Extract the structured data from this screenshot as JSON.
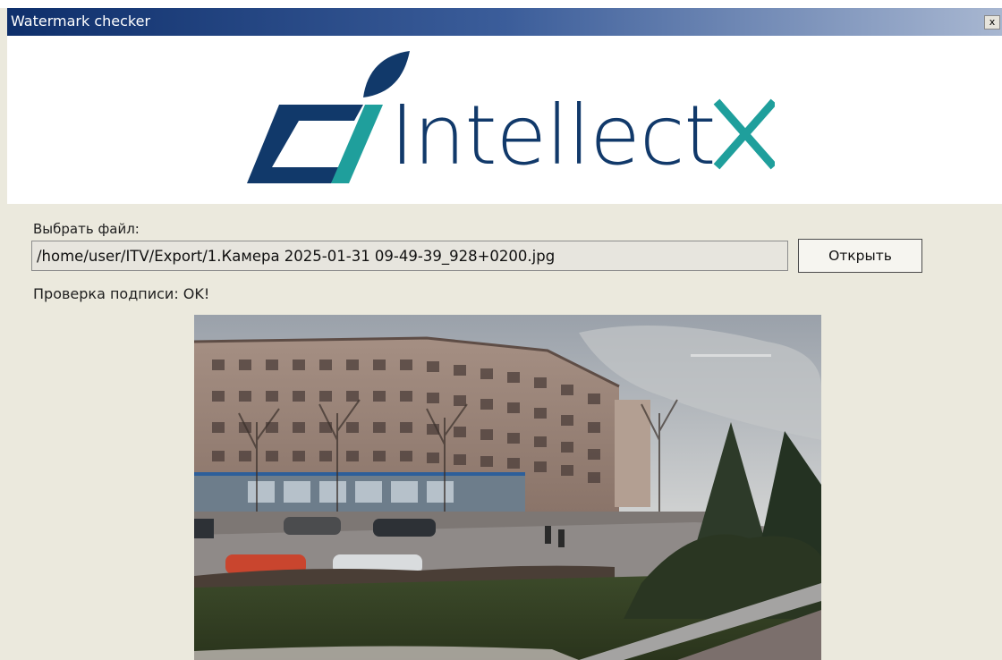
{
  "window": {
    "title": "Watermark checker",
    "close_label": "x"
  },
  "logo": {
    "wordmark": "IntellectX",
    "colors": {
      "navy": "#11396a",
      "teal": "#1f9f9c"
    }
  },
  "file_picker": {
    "label": "Выбрать файл:",
    "path": "/home/user/ITV/Export/1.Камера 2025-01-31 09-49-39_928+0200.jpg",
    "open_button": "Открыть"
  },
  "status": {
    "text": "Проверка подписи: OK!"
  },
  "preview": {
    "icon": "camera-snapshot-image"
  }
}
